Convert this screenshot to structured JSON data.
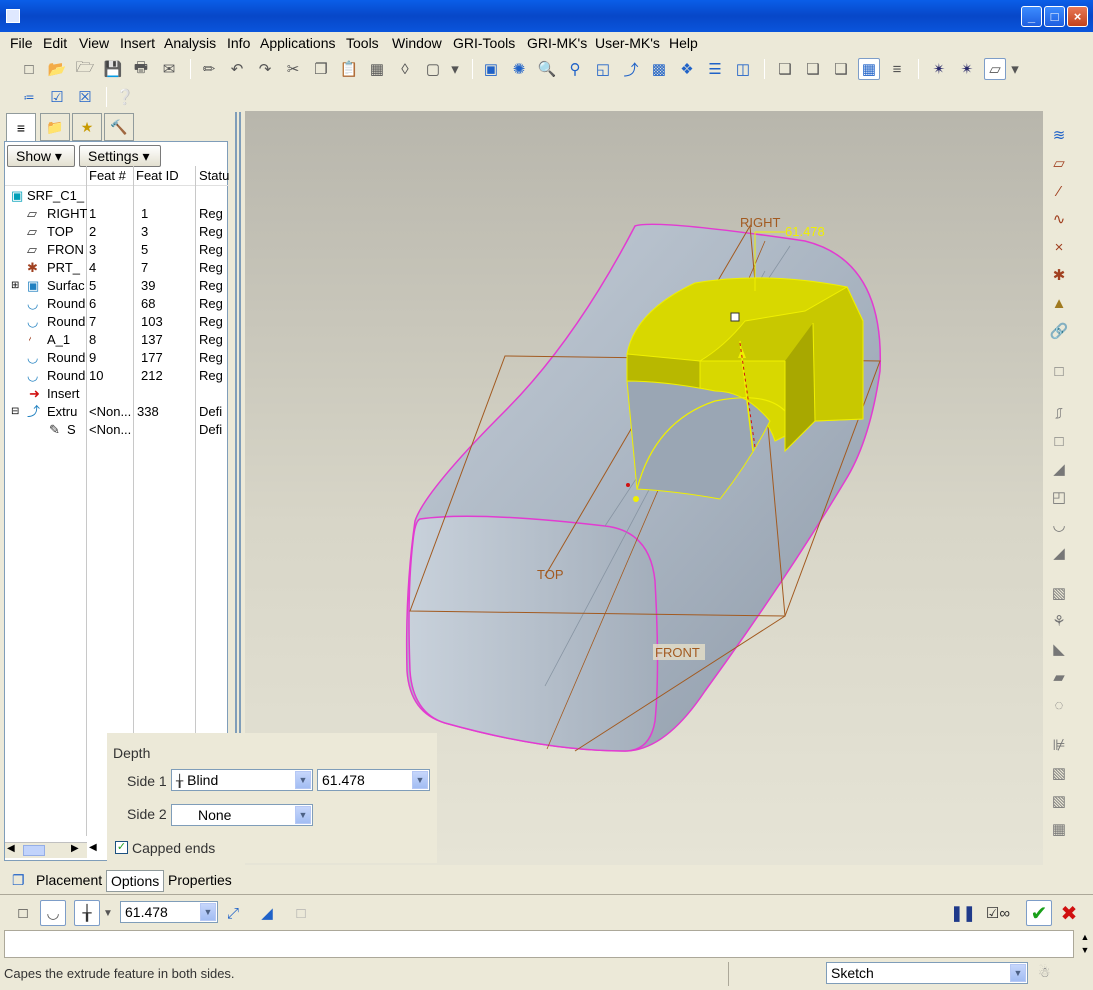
{
  "window": {
    "minimize_glyph": "_",
    "maximize_glyph": "□",
    "close_glyph": "×"
  },
  "menu": [
    "File",
    "Edit",
    "View",
    "Insert",
    "Analysis",
    "Info",
    "Applications",
    "Tools",
    "Window",
    "GRI-Tools",
    "GRI-MK's",
    "User-MK's",
    "Help"
  ],
  "navigator": {
    "show_label": "Show",
    "settings_label": "Settings",
    "columns": {
      "name": "",
      "feat_num": "Feat #",
      "feat_id": "Feat ID",
      "status": "Statu"
    },
    "rows": [
      {
        "name": "SRF_C1_",
        "num": "",
        "id": "",
        "status": ""
      },
      {
        "name": "RIGHT",
        "num": "1",
        "id": "1",
        "status": "Reg"
      },
      {
        "name": "TOP",
        "num": "2",
        "id": "3",
        "status": "Reg"
      },
      {
        "name": "FRON",
        "num": "3",
        "id": "5",
        "status": "Reg"
      },
      {
        "name": "PRT_",
        "num": "4",
        "id": "7",
        "status": "Reg"
      },
      {
        "name": "Surfac",
        "num": "5",
        "id": "39",
        "status": "Reg"
      },
      {
        "name": "Round",
        "num": "6",
        "id": "68",
        "status": "Reg"
      },
      {
        "name": "Round",
        "num": "7",
        "id": "103",
        "status": "Reg"
      },
      {
        "name": "A_1",
        "num": "8",
        "id": "137",
        "status": "Reg"
      },
      {
        "name": "Round",
        "num": "9",
        "id": "177",
        "status": "Reg"
      },
      {
        "name": "Round",
        "num": "10",
        "id": "212",
        "status": "Reg"
      },
      {
        "name": "Insert",
        "num": "",
        "id": "",
        "status": ""
      },
      {
        "name": "Extru",
        "num": "<Non...",
        "id": "338",
        "status": "Defi"
      },
      {
        "name": "S",
        "num": "<Non...",
        "id": "",
        "status": "Defi"
      }
    ]
  },
  "viewport": {
    "labels": {
      "right": "RIGHT",
      "top": "TOP",
      "front": "FRONT",
      "dimension": "61.478"
    },
    "colors": {
      "surface": "#b4bfca",
      "edge": "#e23bd1",
      "selected": "#e8e800",
      "datum": "#a25a20"
    }
  },
  "options": {
    "depth_label": "Depth",
    "side1_label": "Side 1",
    "side1_value": "Blind",
    "side1_depth": "61.478",
    "side2_label": "Side 2",
    "side2_value": "None",
    "capped_label": "Capped ends",
    "capped_checked": true
  },
  "dashboard": {
    "tabs": [
      "Placement",
      "Options",
      "Properties"
    ],
    "depth_value": "61.478"
  },
  "status": {
    "message": "Capes the extrude feature in both sides.",
    "filter_value": "Sketch"
  }
}
